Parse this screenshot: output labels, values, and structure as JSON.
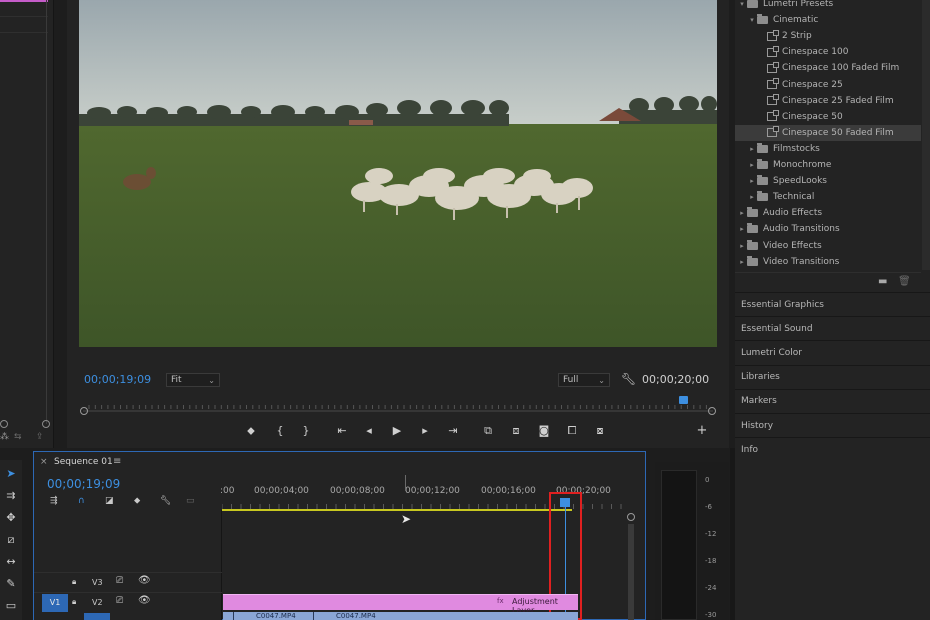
{
  "program_monitor": {
    "current_timecode": "00;00;19;09",
    "duration_timecode": "00;00;20;00",
    "zoom_select": "Fit",
    "resolution_select": "Full",
    "playhead_position": 0.955
  },
  "right_panel": {
    "tree": [
      {
        "label": "Lumetri Presets",
        "indent": 0,
        "type": "folder",
        "expanded": true
      },
      {
        "label": "Cinematic",
        "indent": 1,
        "type": "folder",
        "expanded": true
      },
      {
        "label": "2 Strip",
        "indent": 2,
        "type": "preset"
      },
      {
        "label": "Cinespace 100",
        "indent": 2,
        "type": "preset"
      },
      {
        "label": "Cinespace 100 Faded Film",
        "indent": 2,
        "type": "preset"
      },
      {
        "label": "Cinespace 25",
        "indent": 2,
        "type": "preset"
      },
      {
        "label": "Cinespace 25 Faded Film",
        "indent": 2,
        "type": "preset"
      },
      {
        "label": "Cinespace 50",
        "indent": 2,
        "type": "preset"
      },
      {
        "label": "Cinespace 50 Faded Film",
        "indent": 2,
        "type": "preset",
        "selected": true
      },
      {
        "label": "Filmstocks",
        "indent": 1,
        "type": "folder"
      },
      {
        "label": "Monochrome",
        "indent": 1,
        "type": "folder"
      },
      {
        "label": "SpeedLooks",
        "indent": 1,
        "type": "folder"
      },
      {
        "label": "Technical",
        "indent": 1,
        "type": "folder"
      },
      {
        "label": "Audio Effects",
        "indent": 0,
        "type": "folder"
      },
      {
        "label": "Audio Transitions",
        "indent": 0,
        "type": "folder"
      },
      {
        "label": "Video Effects",
        "indent": 0,
        "type": "folder"
      },
      {
        "label": "Video Transitions",
        "indent": 0,
        "type": "folder"
      }
    ],
    "panels": [
      "Essential Graphics",
      "Essential Sound",
      "Lumetri Color",
      "Libraries",
      "Markers",
      "History",
      "Info"
    ]
  },
  "timeline": {
    "tab_close": "×",
    "sequence_name": "Sequence 01",
    "menu_glyph": "≡",
    "timecode": "00;00;19;09",
    "ruler_labels": [
      "00;00;04;00",
      "00;00;08;00",
      "00;00;12;00",
      "00;00;16;00",
      "00;00;20;00"
    ],
    "ruler_zero": ":00",
    "tracks": [
      {
        "name": "V3",
        "source": ""
      },
      {
        "name": "V2",
        "source": "V1"
      }
    ],
    "clips": {
      "adjustment_layer": "Adjustment Layer",
      "clip_a": "C0047.MP4",
      "clip_b": "C0047.MP4",
      "fx_badge": "fx"
    }
  },
  "audio_meter": {
    "scale": [
      "0",
      "-6",
      "-12",
      "-18",
      "-24",
      "-30"
    ]
  },
  "colors": {
    "accent_blue": "#3d8fe0",
    "adjustment_pink": "#e08ae0",
    "clip_blue": "#8aa6d6",
    "highlight_red": "#e02020",
    "selection_border": "#2d68b5"
  }
}
